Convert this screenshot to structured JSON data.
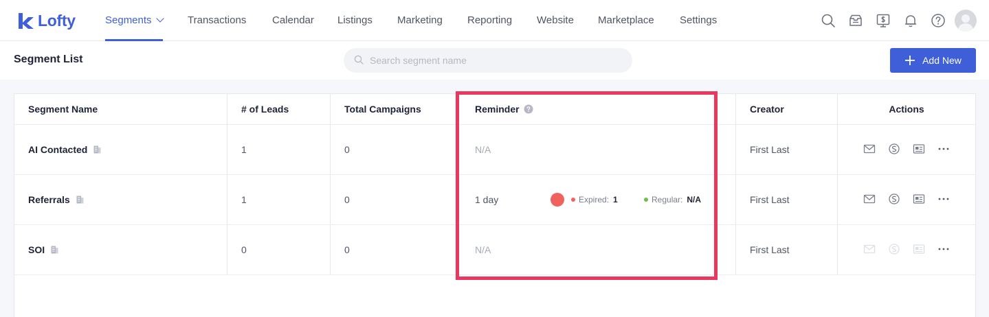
{
  "app": {
    "logo_text": "Lofty",
    "brand_color": "#3f5fd8"
  },
  "nav": {
    "items": [
      {
        "label": "Segments",
        "active": true
      },
      {
        "label": "Transactions"
      },
      {
        "label": "Calendar"
      },
      {
        "label": "Listings"
      },
      {
        "label": "Marketing"
      },
      {
        "label": "Reporting"
      },
      {
        "label": "Website"
      },
      {
        "label": "Marketplace"
      },
      {
        "label": "Settings"
      }
    ],
    "icons": [
      "search-icon",
      "inbox-icon",
      "billing-icon",
      "bell-icon",
      "help-icon",
      "avatar"
    ]
  },
  "header": {
    "title": "Segment List",
    "search_placeholder": "Search segment name",
    "add_label": "Add New"
  },
  "table": {
    "columns": [
      "Segment Name",
      "# of Leads",
      "Total Campaigns",
      "Reminder",
      "Creator",
      "Actions"
    ],
    "rows": [
      {
        "name": "AI Contacted",
        "leads": "1",
        "campaigns": "0",
        "reminder": "N/A",
        "creator": "First Last",
        "actions_enabled": true
      },
      {
        "name": "Referrals",
        "leads": "1",
        "campaigns": "0",
        "reminder": "1 day",
        "expired_label": "Expired:",
        "expired_value": "1",
        "regular_label": "Regular:",
        "regular_value": "N/A",
        "creator": "First Last",
        "actions_enabled": true
      },
      {
        "name": "SOI",
        "leads": "0",
        "campaigns": "0",
        "reminder": "N/A",
        "creator": "First Last",
        "actions_enabled": false
      }
    ]
  },
  "colors": {
    "highlight": "#e8385f",
    "expired": "#f0625d",
    "regular": "#6cc04a"
  }
}
